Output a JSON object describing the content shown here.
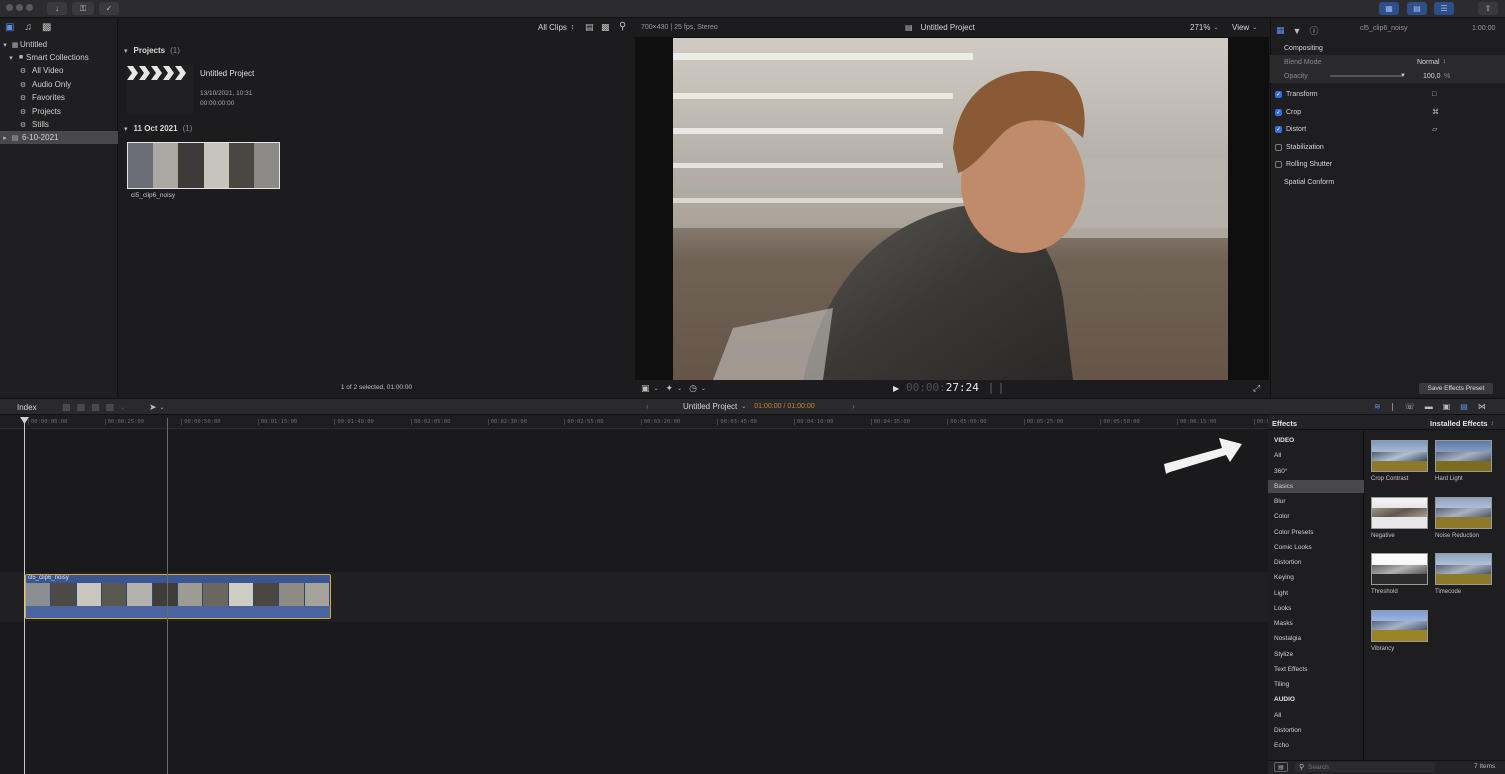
{
  "toolbar": {
    "right_time": "1:00:00"
  },
  "library": {
    "items": [
      {
        "label": "Untitled",
        "indent": 0
      },
      {
        "label": "Smart Collections",
        "indent": 1
      },
      {
        "label": "All Video",
        "indent": 2
      },
      {
        "label": "Audio Only",
        "indent": 2
      },
      {
        "label": "Favorites",
        "indent": 2
      },
      {
        "label": "Projects",
        "indent": 2
      },
      {
        "label": "Stills",
        "indent": 2
      },
      {
        "label": "6-10-2021",
        "indent": 0
      }
    ]
  },
  "browser": {
    "filter": "All Clips",
    "projects_heading": "Projects",
    "projects_count": "(1)",
    "project_name": "Untitled Project",
    "project_date": "13/10/2021, 10:31",
    "project_duration": "00:00:00:00",
    "event_heading": "11 Oct 2021",
    "event_count": "(1)",
    "clip_name": "cl5_clip6_noisy",
    "status": "1 of 2 selected, 01:00:00"
  },
  "viewer": {
    "format": "700×430 | 25 fps, Stereo",
    "title": "Untitled Project",
    "zoom": "271%",
    "view_menu": "View",
    "timecode_dim": "00:00:",
    "timecode": "27:24"
  },
  "inspector": {
    "clip_name": "cl5_clip6_noisy",
    "time": "1:00:00",
    "compositing": "Compositing",
    "blend_mode_label": "Blend Mode",
    "blend_mode_value": "Normal",
    "opacity_label": "Opacity",
    "opacity_value": "100,0",
    "opacity_unit": "%",
    "transform": "Transform",
    "crop": "Crop",
    "distort": "Distort",
    "stabilization": "Stabilization",
    "rolling_shutter": "Rolling Shutter",
    "spatial_conform": "Spatial Conform",
    "save_preset": "Save Effects Preset"
  },
  "timeline": {
    "index_label": "Index",
    "project": "Untitled Project",
    "duration": "01:00:00 / 01:00:00",
    "clip_label": "cl5_clip6_noisy",
    "ruler": [
      "00:00:00:00",
      "00:00:25:00",
      "00:00:50:00",
      "00:01:15:00",
      "00:01:40:00",
      "00:02:05:00",
      "00:02:30:00",
      "00:02:55:00",
      "00:03:20:00",
      "00:03:45:00",
      "00:04:10:00",
      "00:04:35:00",
      "00:05:00:00",
      "00:05:25:00",
      "00:05:50:00",
      "00:06:15:00",
      "00:0"
    ]
  },
  "effects": {
    "title": "Effects",
    "installed": "Installed Effects",
    "categories": [
      {
        "label": "VIDEO",
        "group": true
      },
      {
        "label": "All"
      },
      {
        "label": "360°"
      },
      {
        "label": "Basics",
        "selected": true
      },
      {
        "label": "Blur"
      },
      {
        "label": "Color"
      },
      {
        "label": "Color Presets"
      },
      {
        "label": "Comic Looks"
      },
      {
        "label": "Distortion"
      },
      {
        "label": "Keying"
      },
      {
        "label": "Light"
      },
      {
        "label": "Looks"
      },
      {
        "label": "Masks"
      },
      {
        "label": "Nostalgia"
      },
      {
        "label": "Stylize"
      },
      {
        "label": "Text Effects"
      },
      {
        "label": "Tiling"
      },
      {
        "label": "AUDIO",
        "group": true
      },
      {
        "label": "All"
      },
      {
        "label": "Distortion"
      },
      {
        "label": "Echo"
      }
    ],
    "items": [
      "Crop Contrast",
      "Hard Light",
      "Negative",
      "Noise Reduction",
      "Threshold",
      "Timecode",
      "Vibrancy"
    ],
    "search_placeholder": "Search",
    "count": "7 Items"
  },
  "colors": {
    "accent": "#2f6fd6",
    "clip_border": "#d6a83a",
    "clip_fill": "#3a5690"
  }
}
